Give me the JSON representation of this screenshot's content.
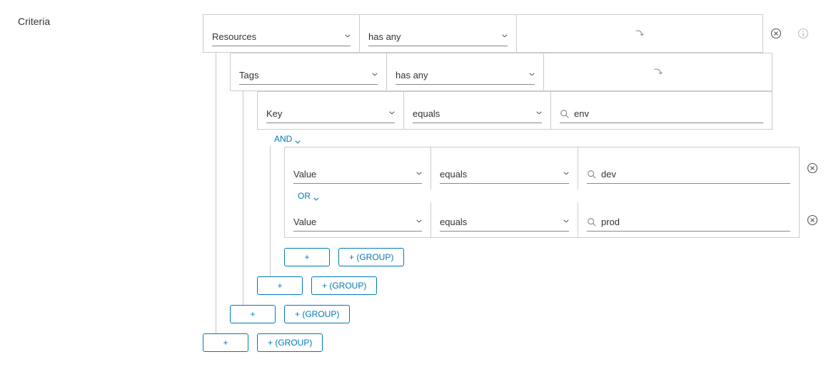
{
  "side_label": "Criteria",
  "connectors": {
    "and": "AND",
    "or": "OR"
  },
  "buttons": {
    "add": "+",
    "add_group": "+ (GROUP)"
  },
  "l0": {
    "subject": "Resources",
    "op": "has any"
  },
  "l1": {
    "subject": "Tags",
    "op": "has any"
  },
  "l2": {
    "subject": "Key",
    "op": "equals",
    "value": "env"
  },
  "l3a": {
    "subject": "Value",
    "op": "equals",
    "value": "dev"
  },
  "l3b": {
    "subject": "Value",
    "op": "equals",
    "value": "prod"
  }
}
